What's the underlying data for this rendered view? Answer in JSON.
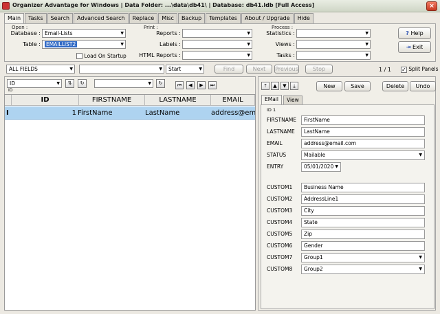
{
  "window": {
    "title": "Organizer Advantage for Windows | Data Folder: ...\\data\\db41\\ | Database: db41.ldb [Full Access]",
    "close_glyph": "×"
  },
  "tabs": [
    "Main",
    "Tasks",
    "Search",
    "Advanced Search",
    "Replace",
    "Misc",
    "Backup",
    "Templates",
    "About / Upgrade",
    "Hide"
  ],
  "open": {
    "legend": "Open :",
    "database_label": "Database :",
    "database_value": "Email-Lists",
    "table_label": "Table :",
    "table_value": "EMAILLIST2",
    "load_on_startup": "Load On Startup"
  },
  "print": {
    "legend": "Print :",
    "reports_label": "Reports :",
    "labels_label": "Labels :",
    "html_reports_label": "HTML Reports :"
  },
  "process": {
    "legend": "Process :",
    "statistics_label": "Statistics :",
    "views_label": "Views :",
    "tasks_label": "Tasks :"
  },
  "help_button": "Help",
  "exit_button": "Exit",
  "search": {
    "field_value": "ALL FIELDS",
    "mode_value": "Start",
    "find": "Find",
    "next": "Next",
    "previous": "Previous",
    "stop": "Stop",
    "record_count": "1 / 1",
    "split_panels": "Split Panels"
  },
  "sort": {
    "field_value": "ID",
    "sub_label": "ID"
  },
  "grid": {
    "columns": [
      "ID",
      "FIRSTNAME",
      "LASTNAME",
      "EMAIL"
    ],
    "rows": [
      {
        "marker": "I",
        "id": "1",
        "firstname": "FirstName",
        "lastname": "LastName",
        "email": "address@email.com"
      }
    ]
  },
  "record": {
    "new": "New",
    "save": "Save",
    "delete": "Delete",
    "undo": "Undo",
    "tabs": [
      "EMail",
      "View"
    ],
    "id_label": "ID 1",
    "fields": [
      {
        "label": "FIRSTNAME",
        "value": "FirstName"
      },
      {
        "label": "LASTNAME",
        "value": "LastName"
      },
      {
        "label": "EMAIL",
        "value": "address@email.com"
      },
      {
        "label": "STATUS",
        "value": "Mailable"
      },
      {
        "label": "ENTRY",
        "value": "05/01/2020"
      }
    ],
    "custom_fields": [
      {
        "label": "CUSTOM1",
        "value": "Business Name"
      },
      {
        "label": "CUSTOM2",
        "value": "AddressLine1"
      },
      {
        "label": "CUSTOM3",
        "value": "City"
      },
      {
        "label": "CUSTOM4",
        "value": "State"
      },
      {
        "label": "CUSTOM5",
        "value": "Zip"
      },
      {
        "label": "CUSTOM6",
        "value": "Gender"
      },
      {
        "label": "CUSTOM7",
        "value": "Group1"
      },
      {
        "label": "CUSTOM8",
        "value": "Group2"
      }
    ]
  },
  "colors": {
    "selection": "#316ac5",
    "row_highlight": "#aed3f0",
    "panel_bg": "#f1efe8"
  }
}
